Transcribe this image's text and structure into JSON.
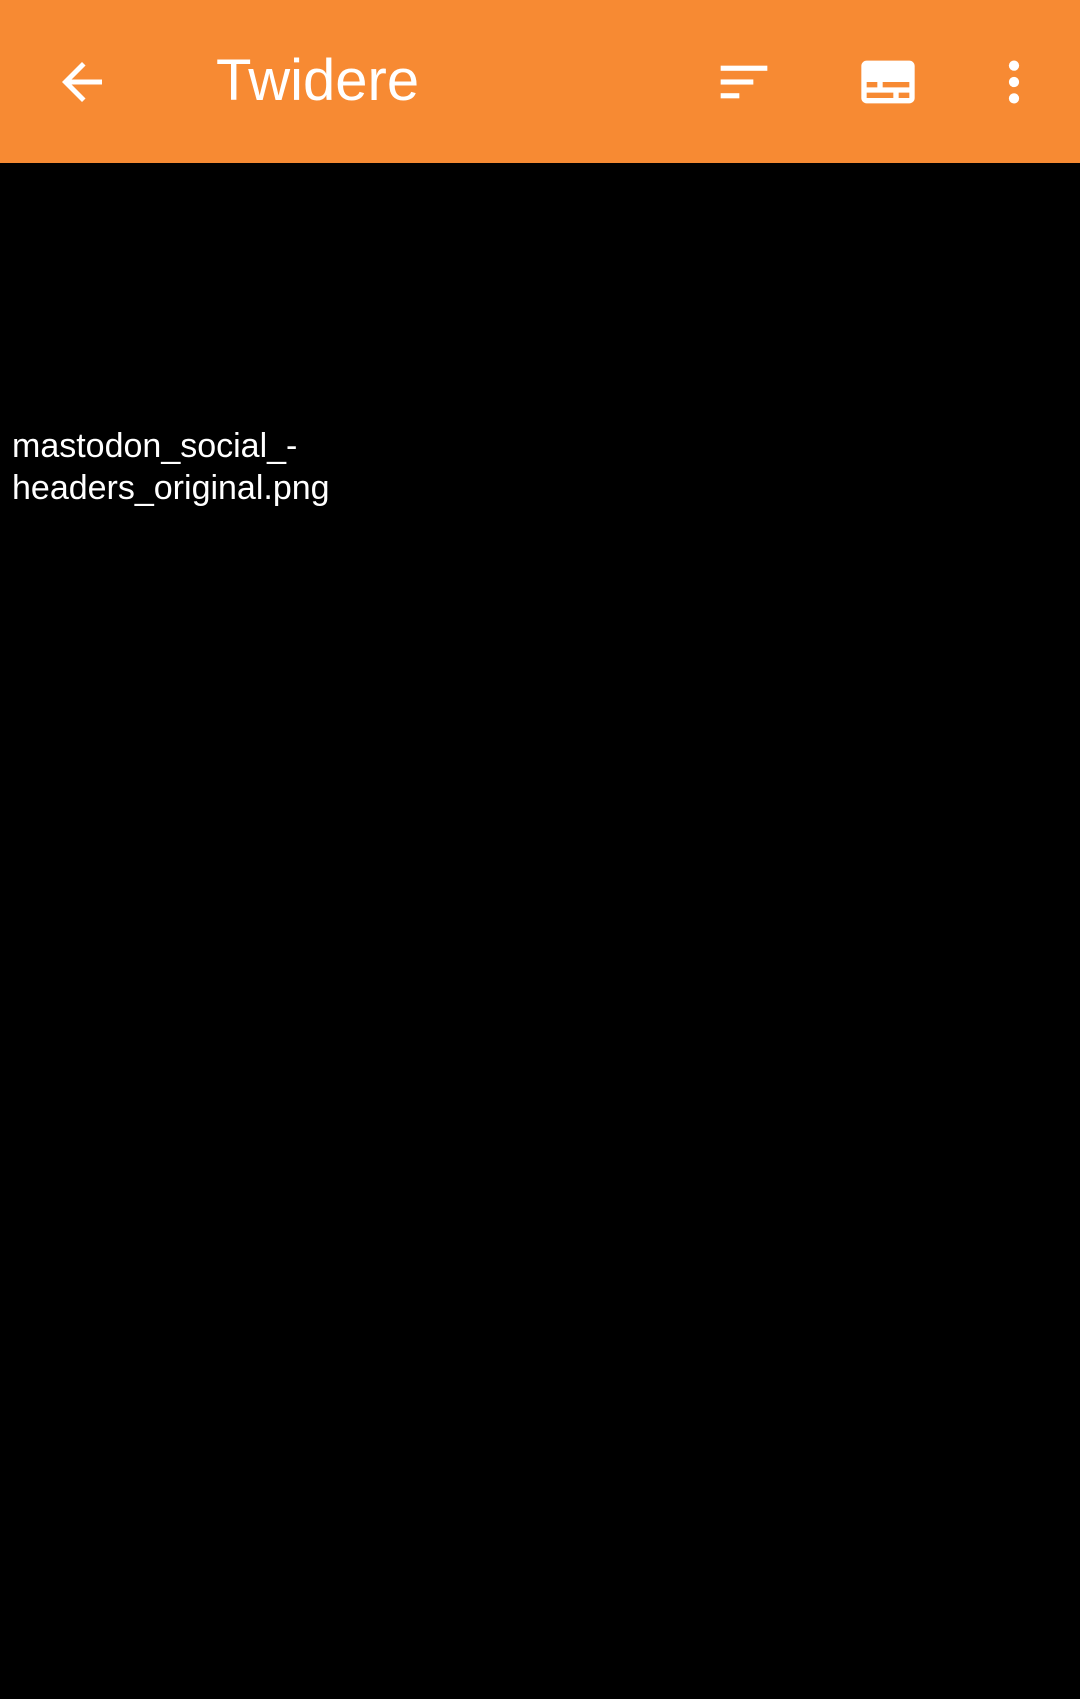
{
  "toolbar": {
    "title": "Twidere",
    "back_icon": "arrow-back-icon",
    "filter_icon": "filter-list-icon",
    "subtitles_icon": "subtitles-icon",
    "more_icon": "more-vert-icon",
    "background": "#F78A33"
  },
  "content": {
    "image_alt_line1": "mastodon_social_-",
    "image_alt_line2": "headers_original.png"
  }
}
